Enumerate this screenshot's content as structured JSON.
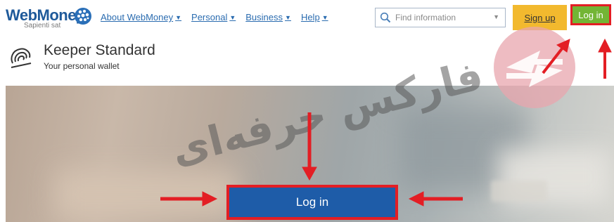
{
  "header": {
    "logo": {
      "name": "WebMoney",
      "tagline": "Sapienti sat"
    },
    "nav": [
      {
        "label": "About WebMoney"
      },
      {
        "label": "Personal"
      },
      {
        "label": "Business"
      },
      {
        "label": "Help"
      }
    ],
    "search": {
      "placeholder": "Find information"
    },
    "signup_label": "Sign up",
    "login_label": "Log in"
  },
  "page": {
    "title": "Keeper Standard",
    "subtitle": "Your personal wallet"
  },
  "hero": {
    "login_label": "Log in"
  },
  "watermark": {
    "text": "فارکس حرفه‌ای"
  },
  "colors": {
    "brand_blue": "#1f5a9a",
    "signup_yellow": "#f2b92e",
    "login_green": "#73b535",
    "login_blue": "#1e5ca8",
    "highlight_red": "#e31e24"
  }
}
